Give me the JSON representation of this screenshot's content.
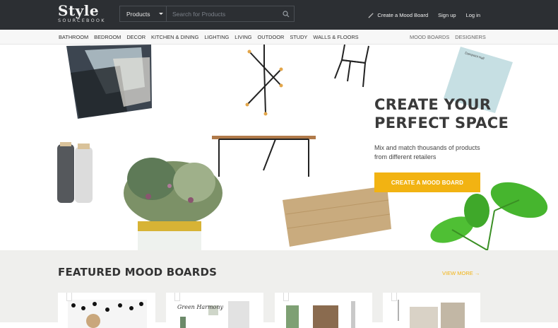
{
  "brand": {
    "name": "Style",
    "sub": "SOURCEBOOK"
  },
  "search": {
    "category": "Products",
    "placeholder": "Search for Products"
  },
  "top_links": {
    "create": "Create a Mood Board",
    "signup": "Sign up",
    "login": "Log in"
  },
  "categories": [
    "BATHROOM",
    "BEDROOM",
    "DECOR",
    "KITCHEN & DINING",
    "LIGHTING",
    "LIVING",
    "OUTDOOR",
    "STUDY",
    "WALLS & FLOORS"
  ],
  "right_nav": [
    "MOOD BOARDS",
    "DESIGNERS"
  ],
  "hero": {
    "title_line1": "CREATE YOUR",
    "title_line2": "PERFECT SPACE",
    "subtitle": "Mix and match thousands of products from different retailers",
    "cta": "CREATE A MOOD BOARD",
    "swatch_label": "Dampoint Hall"
  },
  "featured": {
    "title": "FEATURED MOOD BOARDS",
    "view_more": "VIEW MORE →",
    "card2_text": "Green Harmony"
  },
  "colors": {
    "accent": "#f2b312",
    "topbar": "#2c2f33"
  }
}
